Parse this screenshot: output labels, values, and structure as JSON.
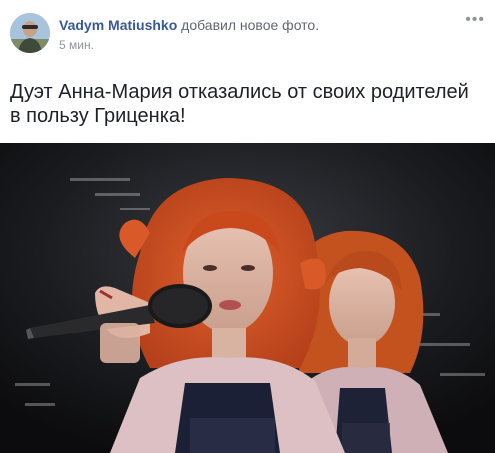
{
  "post": {
    "author_name": "Vadym Matiushko",
    "action_text": "добавил новое фото.",
    "time": "5 мин.",
    "more_icon": "more-horizontal-icon",
    "text": "Дуэт Анна-Мария отказались от своих родителей в пользу Гриценка!"
  },
  "colors": {
    "author_link": "#385898",
    "secondary_text": "#616770",
    "timestamp": "#90949c",
    "body_text": "#1d2129"
  }
}
